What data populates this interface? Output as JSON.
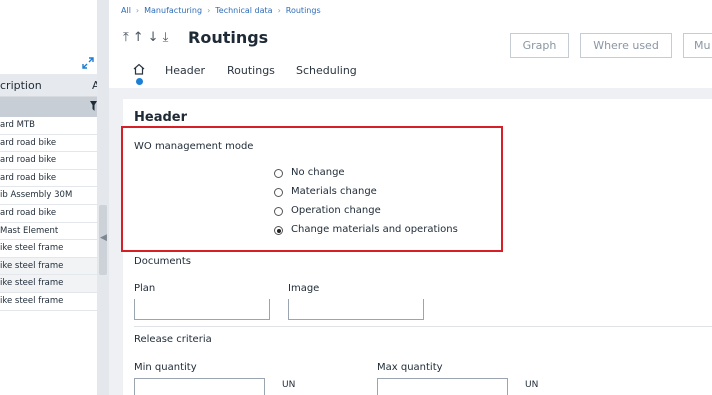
{
  "breadcrumb": [
    "All",
    "Manufacturing",
    "Technical data",
    "Routings"
  ],
  "page": {
    "title": "Routings"
  },
  "toolbar": {
    "graph": "Graph",
    "where_used": "Where used",
    "more": "Mu"
  },
  "tabs": [
    {
      "label": "Header"
    },
    {
      "label": "Routings"
    },
    {
      "label": "Scheduling"
    }
  ],
  "left_panel": {
    "column_header": "cription",
    "column_header_2": "A",
    "rows": [
      "ard MTB",
      "ard road bike",
      "ard road bike",
      "ard road bike",
      "ib Assembly 30M",
      "ard road bike",
      "Mast Element",
      "ike steel frame",
      "ike steel frame",
      "ike steel frame",
      "ike steel frame"
    ]
  },
  "header_section": {
    "title": "Header",
    "wo_mode_label": "WO management mode",
    "options": [
      {
        "label": "No change",
        "selected": false
      },
      {
        "label": "Materials change",
        "selected": false
      },
      {
        "label": "Operation change",
        "selected": false
      },
      {
        "label": "Change materials and operations",
        "selected": true
      }
    ],
    "documents_label": "Documents",
    "plan_label": "Plan",
    "plan_value": "",
    "image_label": "Image",
    "image_value": "",
    "release_label": "Release criteria",
    "min_qty_label": "Min quantity",
    "min_qty_value": "",
    "max_qty_label": "Max quantity",
    "max_qty_value": "",
    "unit_1": "UN",
    "unit_2": "UN"
  },
  "colors": {
    "accent": "#1b7fd4",
    "highlight": "#d61f26",
    "link": "#2e6db8"
  }
}
